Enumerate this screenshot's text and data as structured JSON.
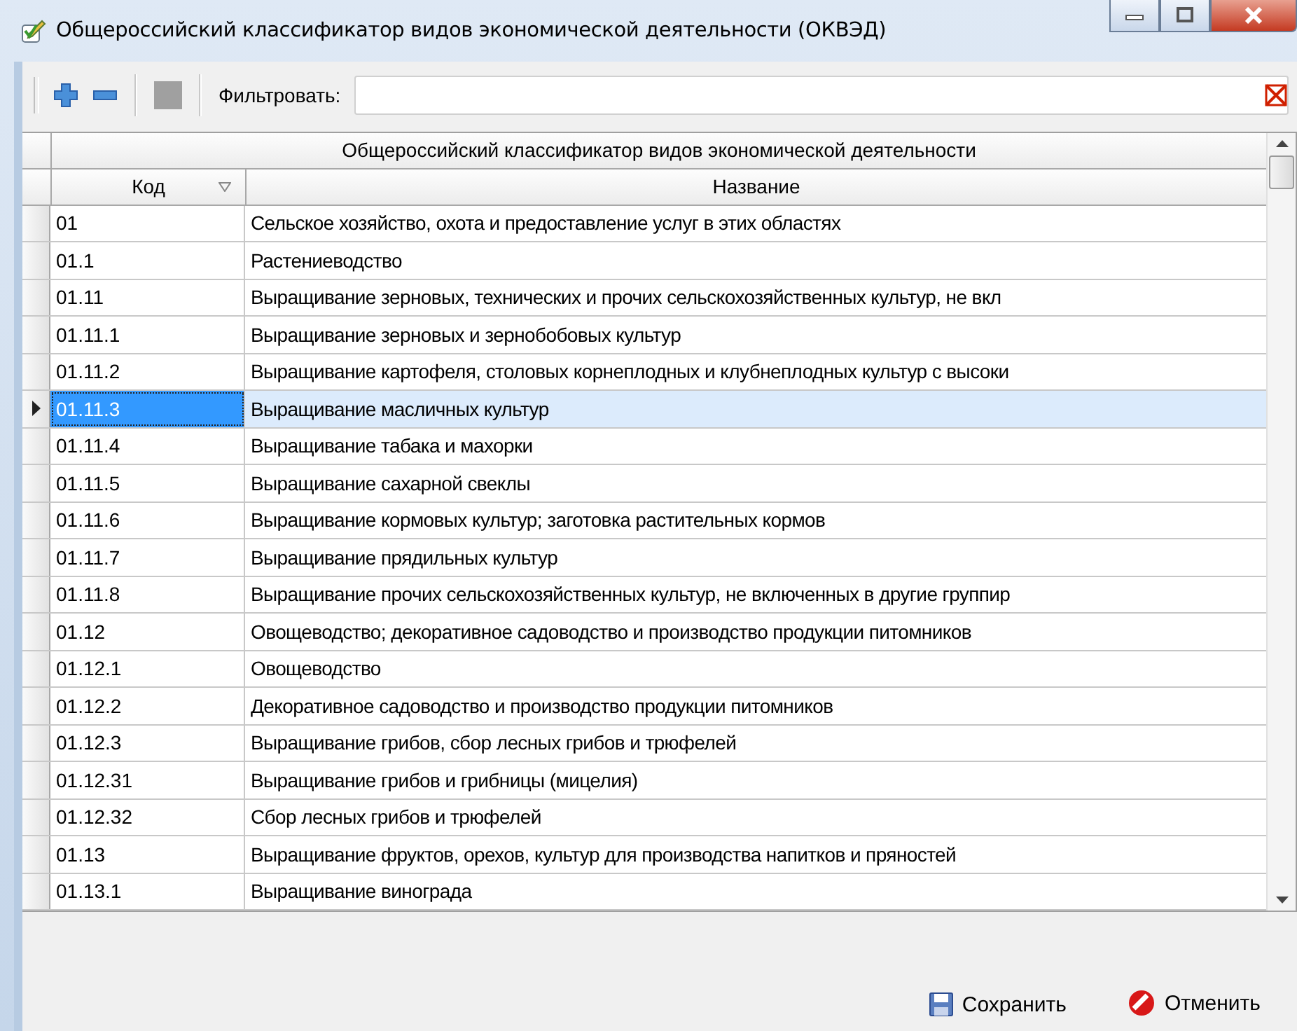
{
  "window": {
    "title": "Общероссийский классификатор видов экономической деятельности (ОКВЭД)"
  },
  "toolbar": {
    "filter_label": "Фильтровать:"
  },
  "table": {
    "group_header": "Общероссийский классификатор видов экономической деятельности",
    "columns": [
      {
        "label": "Код",
        "sorted": true
      },
      {
        "label": "Название",
        "sorted": false
      }
    ],
    "rows": [
      {
        "code": "01",
        "name": "Сельское хозяйство, охота и предоставление услуг в этих областях",
        "selected": false
      },
      {
        "code": "01.1",
        "name": "Растениеводство",
        "selected": false
      },
      {
        "code": "01.11",
        "name": "Выращивание зерновых, технических и прочих сельскохозяйственных культур, не вкл",
        "selected": false
      },
      {
        "code": "01.11.1",
        "name": "Выращивание зерновых и зернобобовых культур",
        "selected": false
      },
      {
        "code": "01.11.2",
        "name": "Выращивание картофеля, столовых корнеплодных и клубнеплодных культур с высоки",
        "selected": false
      },
      {
        "code": "01.11.3",
        "name": "Выращивание масличных культур",
        "selected": true
      },
      {
        "code": "01.11.4",
        "name": "Выращивание табака и махорки",
        "selected": false
      },
      {
        "code": "01.11.5",
        "name": "Выращивание сахарной свеклы",
        "selected": false
      },
      {
        "code": "01.11.6",
        "name": "Выращивание кормовых культур; заготовка растительных кормов",
        "selected": false
      },
      {
        "code": "01.11.7",
        "name": "Выращивание прядильных культур",
        "selected": false
      },
      {
        "code": "01.11.8",
        "name": "Выращивание прочих сельскохозяйственных культур, не включенных в другие группир",
        "selected": false
      },
      {
        "code": "01.12",
        "name": "Овощеводство; декоративное садоводство и производство продукции питомников",
        "selected": false
      },
      {
        "code": "01.12.1",
        "name": "Овощеводство",
        "selected": false
      },
      {
        "code": "01.12.2",
        "name": "Декоративное садоводство и производство продукции питомников",
        "selected": false
      },
      {
        "code": "01.12.3",
        "name": "Выращивание грибов, сбор лесных грибов и трюфелей",
        "selected": false
      },
      {
        "code": "01.12.31",
        "name": "Выращивание грибов и грибницы (мицелия)",
        "selected": false
      },
      {
        "code": "01.12.32",
        "name": "Сбор лесных грибов и трюфелей",
        "selected": false
      },
      {
        "code": "01.13",
        "name": "Выращивание фруктов, орехов, культур для производства напитков и пряностей",
        "selected": false
      },
      {
        "code": "01.13.1",
        "name": "Выращивание винограда",
        "selected": false
      }
    ]
  },
  "buttons": [
    {
      "kind": "save",
      "label": "Сохранить"
    },
    {
      "kind": "cancel",
      "label": "Отменить"
    }
  ]
}
